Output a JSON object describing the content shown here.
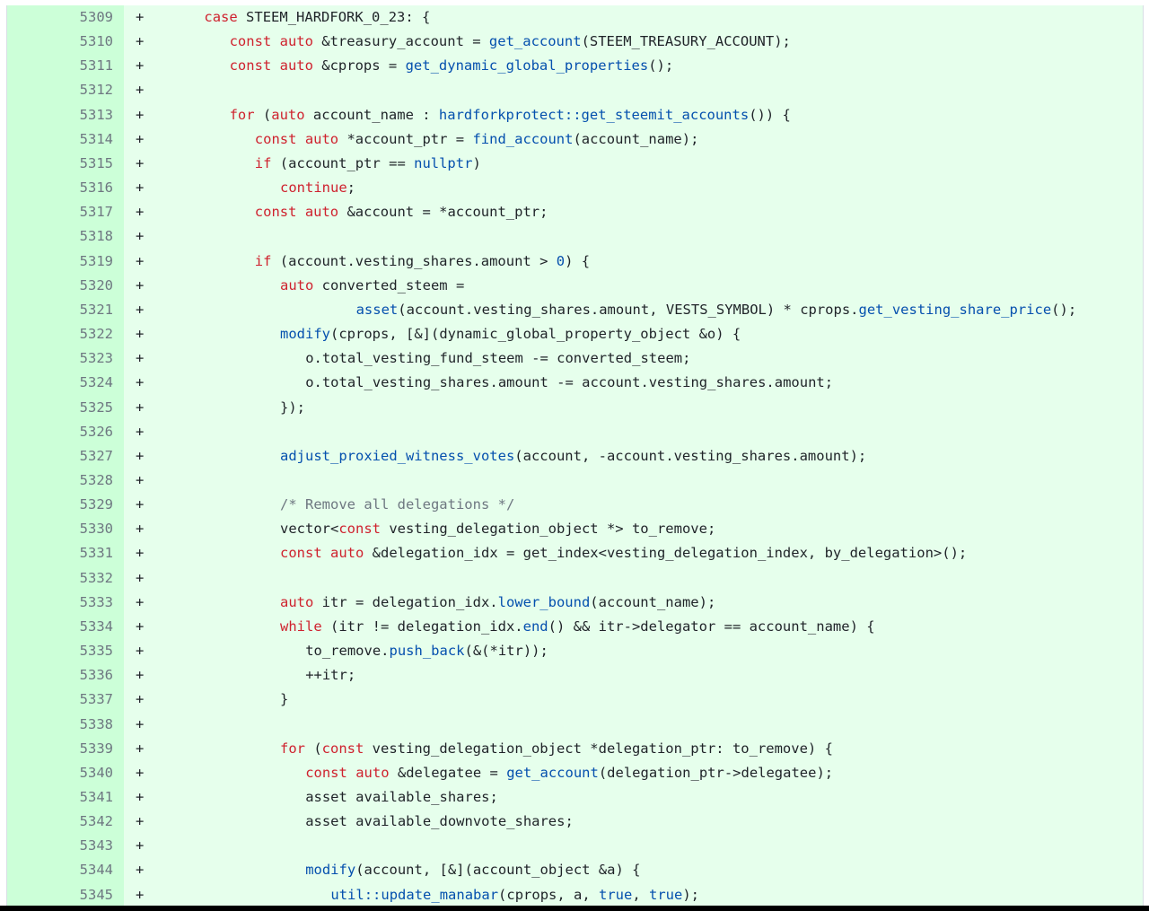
{
  "diff": {
    "lines": [
      {
        "number": "5309",
        "marker": "+",
        "indent": 2,
        "tokens": [
          [
            "keyword",
            "case"
          ],
          [
            "text",
            " STEEM_HARDFORK_0_23: {"
          ]
        ]
      },
      {
        "number": "5310",
        "marker": "+",
        "indent": 3,
        "tokens": [
          [
            "keyword",
            "const"
          ],
          [
            "text",
            " "
          ],
          [
            "keyword",
            "auto"
          ],
          [
            "text",
            " &treasury_account = "
          ],
          [
            "func",
            "get_account"
          ],
          [
            "text",
            "(STEEM_TREASURY_ACCOUNT);"
          ]
        ]
      },
      {
        "number": "5311",
        "marker": "+",
        "indent": 3,
        "tokens": [
          [
            "keyword",
            "const"
          ],
          [
            "text",
            " "
          ],
          [
            "keyword",
            "auto"
          ],
          [
            "text",
            " &cprops = "
          ],
          [
            "func",
            "get_dynamic_global_properties"
          ],
          [
            "text",
            "();"
          ]
        ]
      },
      {
        "number": "5312",
        "marker": "+",
        "indent": 0,
        "tokens": []
      },
      {
        "number": "5313",
        "marker": "+",
        "indent": 3,
        "tokens": [
          [
            "keyword",
            "for"
          ],
          [
            "text",
            " ("
          ],
          [
            "keyword",
            "auto"
          ],
          [
            "text",
            " account_name : "
          ],
          [
            "func",
            "hardforkprotect::get_steemit_accounts"
          ],
          [
            "text",
            "()) {"
          ]
        ]
      },
      {
        "number": "5314",
        "marker": "+",
        "indent": 4,
        "tokens": [
          [
            "keyword",
            "const"
          ],
          [
            "text",
            " "
          ],
          [
            "keyword",
            "auto"
          ],
          [
            "text",
            " *account_ptr = "
          ],
          [
            "func",
            "find_account"
          ],
          [
            "text",
            "(account_name);"
          ]
        ]
      },
      {
        "number": "5315",
        "marker": "+",
        "indent": 4,
        "tokens": [
          [
            "keyword",
            "if"
          ],
          [
            "text",
            " (account_ptr == "
          ],
          [
            "const",
            "nullptr"
          ],
          [
            "text",
            ")"
          ]
        ]
      },
      {
        "number": "5316",
        "marker": "+",
        "indent": 5,
        "tokens": [
          [
            "keyword",
            "continue"
          ],
          [
            "text",
            ";"
          ]
        ]
      },
      {
        "number": "5317",
        "marker": "+",
        "indent": 4,
        "tokens": [
          [
            "keyword",
            "const"
          ],
          [
            "text",
            " "
          ],
          [
            "keyword",
            "auto"
          ],
          [
            "text",
            " &account = *account_ptr;"
          ]
        ]
      },
      {
        "number": "5318",
        "marker": "+",
        "indent": 0,
        "tokens": []
      },
      {
        "number": "5319",
        "marker": "+",
        "indent": 4,
        "tokens": [
          [
            "keyword",
            "if"
          ],
          [
            "text",
            " (account.vesting_shares.amount > "
          ],
          [
            "const",
            "0"
          ],
          [
            "text",
            ") {"
          ]
        ]
      },
      {
        "number": "5320",
        "marker": "+",
        "indent": 5,
        "tokens": [
          [
            "keyword",
            "auto"
          ],
          [
            "text",
            " converted_steem ="
          ]
        ]
      },
      {
        "number": "5321",
        "marker": "+",
        "indent": 8,
        "tokens": [
          [
            "func",
            "asset"
          ],
          [
            "text",
            "(account.vesting_shares.amount, VESTS_SYMBOL) * cprops."
          ],
          [
            "func",
            "get_vesting_share_price"
          ],
          [
            "text",
            "();"
          ]
        ]
      },
      {
        "number": "5322",
        "marker": "+",
        "indent": 5,
        "tokens": [
          [
            "func",
            "modify"
          ],
          [
            "text",
            "(cprops, [&](dynamic_global_property_object &o) {"
          ]
        ]
      },
      {
        "number": "5323",
        "marker": "+",
        "indent": 6,
        "tokens": [
          [
            "text",
            "o.total_vesting_fund_steem -= converted_steem;"
          ]
        ]
      },
      {
        "number": "5324",
        "marker": "+",
        "indent": 6,
        "tokens": [
          [
            "text",
            "o.total_vesting_shares.amount -= account.vesting_shares.amount;"
          ]
        ]
      },
      {
        "number": "5325",
        "marker": "+",
        "indent": 5,
        "tokens": [
          [
            "text",
            "});"
          ]
        ]
      },
      {
        "number": "5326",
        "marker": "+",
        "indent": 0,
        "tokens": []
      },
      {
        "number": "5327",
        "marker": "+",
        "indent": 5,
        "tokens": [
          [
            "func",
            "adjust_proxied_witness_votes"
          ],
          [
            "text",
            "(account, -account.vesting_shares.amount);"
          ]
        ]
      },
      {
        "number": "5328",
        "marker": "+",
        "indent": 0,
        "tokens": []
      },
      {
        "number": "5329",
        "marker": "+",
        "indent": 5,
        "tokens": [
          [
            "comment",
            "/* Remove all delegations */"
          ]
        ]
      },
      {
        "number": "5330",
        "marker": "+",
        "indent": 5,
        "tokens": [
          [
            "text",
            "vector<"
          ],
          [
            "keyword",
            "const"
          ],
          [
            "text",
            " vesting_delegation_object *> to_remove;"
          ]
        ]
      },
      {
        "number": "5331",
        "marker": "+",
        "indent": 5,
        "tokens": [
          [
            "keyword",
            "const"
          ],
          [
            "text",
            " "
          ],
          [
            "keyword",
            "auto"
          ],
          [
            "text",
            " &delegation_idx = get_index<vesting_delegation_index, by_delegation>();"
          ]
        ]
      },
      {
        "number": "5332",
        "marker": "+",
        "indent": 0,
        "tokens": []
      },
      {
        "number": "5333",
        "marker": "+",
        "indent": 5,
        "tokens": [
          [
            "keyword",
            "auto"
          ],
          [
            "text",
            " itr = delegation_idx."
          ],
          [
            "func",
            "lower_bound"
          ],
          [
            "text",
            "(account_name);"
          ]
        ]
      },
      {
        "number": "5334",
        "marker": "+",
        "indent": 5,
        "tokens": [
          [
            "keyword",
            "while"
          ],
          [
            "text",
            " (itr != delegation_idx."
          ],
          [
            "func",
            "end"
          ],
          [
            "text",
            "() && itr->delegator == account_name) {"
          ]
        ]
      },
      {
        "number": "5335",
        "marker": "+",
        "indent": 6,
        "tokens": [
          [
            "text",
            "to_remove."
          ],
          [
            "func",
            "push_back"
          ],
          [
            "text",
            "(&(*itr));"
          ]
        ]
      },
      {
        "number": "5336",
        "marker": "+",
        "indent": 6,
        "tokens": [
          [
            "text",
            "++itr;"
          ]
        ]
      },
      {
        "number": "5337",
        "marker": "+",
        "indent": 5,
        "tokens": [
          [
            "text",
            "}"
          ]
        ]
      },
      {
        "number": "5338",
        "marker": "+",
        "indent": 0,
        "tokens": []
      },
      {
        "number": "5339",
        "marker": "+",
        "indent": 5,
        "tokens": [
          [
            "keyword",
            "for"
          ],
          [
            "text",
            " ("
          ],
          [
            "keyword",
            "const"
          ],
          [
            "text",
            " vesting_delegation_object *delegation_ptr: to_remove) {"
          ]
        ]
      },
      {
        "number": "5340",
        "marker": "+",
        "indent": 6,
        "tokens": [
          [
            "keyword",
            "const"
          ],
          [
            "text",
            " "
          ],
          [
            "keyword",
            "auto"
          ],
          [
            "text",
            " &delegatee = "
          ],
          [
            "func",
            "get_account"
          ],
          [
            "text",
            "(delegation_ptr->delegatee);"
          ]
        ]
      },
      {
        "number": "5341",
        "marker": "+",
        "indent": 6,
        "tokens": [
          [
            "text",
            "asset available_shares;"
          ]
        ]
      },
      {
        "number": "5342",
        "marker": "+",
        "indent": 6,
        "tokens": [
          [
            "text",
            "asset available_downvote_shares;"
          ]
        ]
      },
      {
        "number": "5343",
        "marker": "+",
        "indent": 0,
        "tokens": []
      },
      {
        "number": "5344",
        "marker": "+",
        "indent": 6,
        "tokens": [
          [
            "func",
            "modify"
          ],
          [
            "text",
            "(account, [&](account_object &a) {"
          ]
        ]
      },
      {
        "number": "5345",
        "marker": "+",
        "indent": 7,
        "tokens": [
          [
            "func",
            "util::update_manabar"
          ],
          [
            "text",
            "(cprops, a, "
          ],
          [
            "const",
            "true"
          ],
          [
            "text",
            ", "
          ],
          [
            "const",
            "true"
          ],
          [
            "text",
            ");"
          ]
        ]
      }
    ]
  },
  "colors": {
    "added_line_bg": "#e6ffec",
    "added_gutter_bg": "#ccffd8",
    "keyword": "#cf222e",
    "function": "#0550ae",
    "comment": "#6e7781"
  }
}
